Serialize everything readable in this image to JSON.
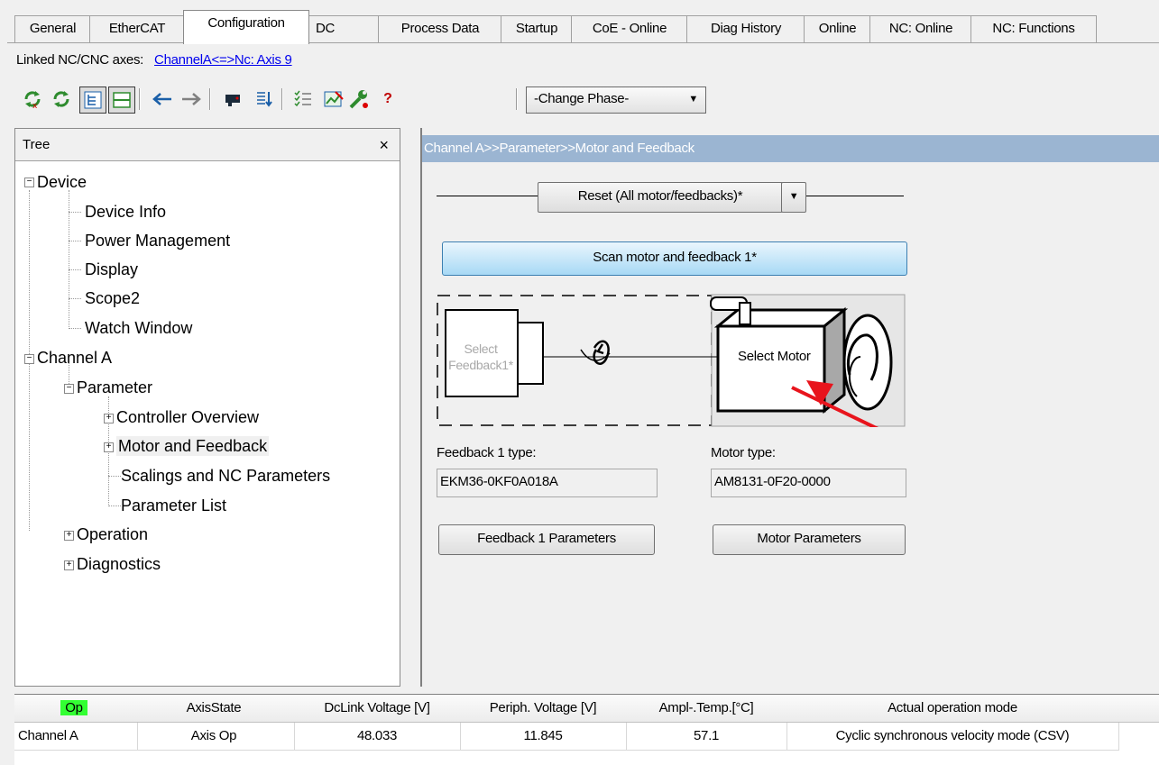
{
  "tabs": [
    "General",
    "EtherCAT",
    "Configuration",
    "DC",
    "Process Data",
    "Startup",
    "CoE - Online",
    "Diag History",
    "Online",
    "NC: Online",
    "NC: Functions"
  ],
  "active_tab": "Configuration",
  "linked": {
    "label": "Linked NC/CNC axes:",
    "link": "ChannelA<=>Nc: Axis 9"
  },
  "toolbar": {
    "help": "?",
    "phase": "-Change Phase-"
  },
  "tree": {
    "header": "Tree",
    "close": "×",
    "nodes": [
      "Device",
      "Device Info",
      "Power Management",
      "Display",
      "Scope2",
      "Watch Window",
      "Channel A",
      "Parameter",
      "Controller Overview",
      "Motor and Feedback",
      "Scalings and NC Parameters",
      "Parameter List",
      "Operation",
      "Diagnostics"
    ]
  },
  "main": {
    "breadcrumb": "Channel A>>Parameter>>Motor and Feedback",
    "reset_button": "Reset (All motor/feedbacks)*",
    "scan_button": "Scan motor and feedback 1*",
    "select_feedback": "Select Feedback1*",
    "select_motor": "Select Motor",
    "feedback_type_label": "Feedback 1 type:",
    "feedback_type_value": "EKM36-0KF0A018A",
    "motor_type_label": "Motor type:",
    "motor_type_value": "AM8131-0F20-0000",
    "feedback_params_button": "Feedback 1 Parameters",
    "motor_params_button": "Motor Parameters"
  },
  "status": {
    "headers": [
      "Op",
      "AxisState",
      "DcLink Voltage [V]",
      "Periph. Voltage [V]",
      "Ampl-.Temp.[°C]",
      "Actual operation mode"
    ],
    "row": [
      "Channel A",
      "Axis Op",
      "48.033",
      "11.845",
      "57.1",
      "Cyclic synchronous velocity mode (CSV)"
    ],
    "op_color": "#33ff33"
  }
}
